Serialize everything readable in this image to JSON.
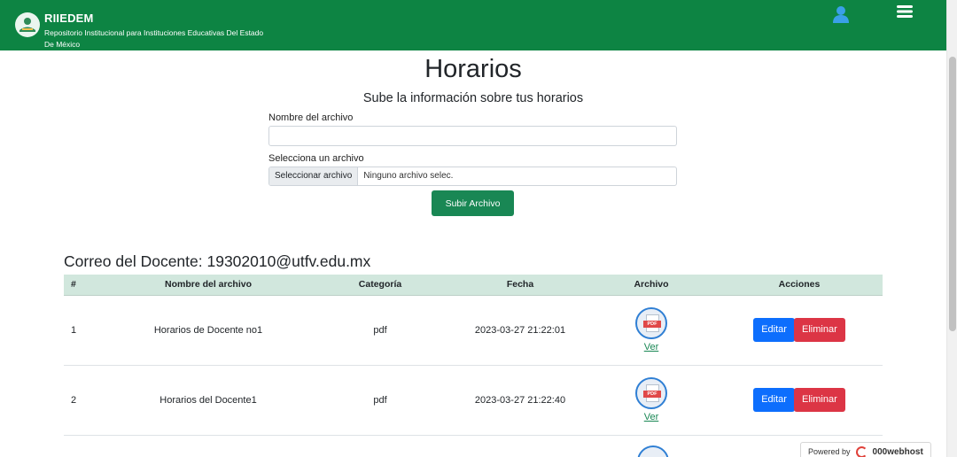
{
  "header": {
    "brand": "RIIEDEM",
    "subtitle": "Repositorio Institucional para Instituciones Educativas Del Estado De México"
  },
  "page": {
    "title": "Horarios",
    "subtitle": "Sube la información sobre tus horarios"
  },
  "form": {
    "name_label": "Nombre del archivo",
    "name_value": "",
    "file_label": "Selecciona un archivo",
    "file_button": "Seleccionar archivo",
    "file_status": "Ninguno archivo selec.",
    "submit": "Subir Archivo"
  },
  "email_heading": "Correo del Docente: 19302010@utfv.edu.mx",
  "table": {
    "headers": [
      "#",
      "Nombre del archivo",
      "Categoría",
      "Fecha",
      "Archivo",
      "Acciones"
    ],
    "rows": [
      {
        "num": "1",
        "name": "Horarios de Docente no1",
        "category": "pdf",
        "date": "2023-03-27 21:22:01",
        "icon_text": "PDF",
        "link": "Ver",
        "edit": "Editar",
        "delete": "Eliminar"
      },
      {
        "num": "2",
        "name": "Horarios del Docente1",
        "category": "pdf",
        "date": "2023-03-27 21:22:40",
        "icon_text": "PDF",
        "link": "Ver",
        "edit": "Editar",
        "delete": "Eliminar"
      }
    ]
  },
  "footer": {
    "powered": "Powered by",
    "host": "000webhost"
  },
  "colors": {
    "navbar": "#0d8443",
    "table_header": "#d1e7dd",
    "submit": "#198754",
    "edit": "#0d6efd",
    "delete": "#dc3545"
  },
  "icons": [
    "logo-icon",
    "user-icon",
    "menu-icon",
    "pdf-icon",
    "webhost-icon"
  ]
}
